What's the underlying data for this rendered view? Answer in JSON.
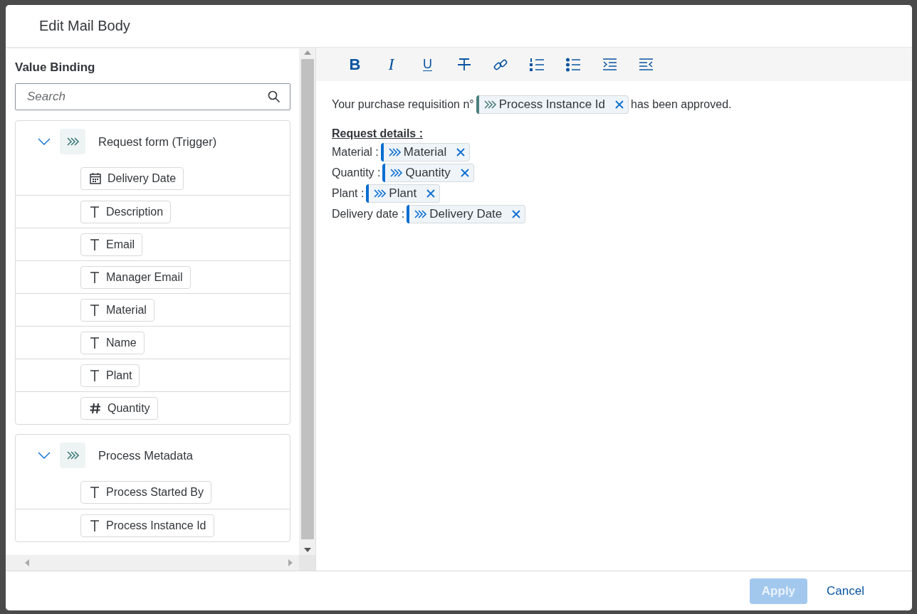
{
  "dialog": {
    "title": "Edit Mail Body"
  },
  "value_binding": {
    "title": "Value Binding",
    "search": {
      "placeholder": "Search"
    },
    "groups": [
      {
        "label": "Request form (Trigger)",
        "expanded": true,
        "fields": [
          {
            "label": "Delivery Date",
            "kind": "date"
          },
          {
            "label": "Description",
            "kind": "text"
          },
          {
            "label": "Email",
            "kind": "text"
          },
          {
            "label": "Manager Email",
            "kind": "text"
          },
          {
            "label": "Material",
            "kind": "text"
          },
          {
            "label": "Name",
            "kind": "text"
          },
          {
            "label": "Plant",
            "kind": "text"
          },
          {
            "label": "Quantity",
            "kind": "number"
          }
        ]
      },
      {
        "label": "Process Metadata",
        "expanded": true,
        "fields": [
          {
            "label": "Process Started By",
            "kind": "text"
          },
          {
            "label": "Process Instance Id",
            "kind": "text"
          }
        ]
      }
    ]
  },
  "toolbar": [
    {
      "kind": "bold",
      "label": "B"
    },
    {
      "kind": "italic",
      "label": "I"
    },
    {
      "kind": "underline",
      "label": "U"
    },
    {
      "kind": "strikethrough"
    },
    {
      "kind": "link"
    },
    {
      "kind": "numbered-list"
    },
    {
      "kind": "bulleted-list"
    },
    {
      "kind": "indent"
    },
    {
      "kind": "outdent"
    }
  ],
  "editor": {
    "lines": [
      {
        "kind": "line",
        "parts": [
          {
            "kind": "text",
            "text": "Your purchase requisition n°"
          },
          {
            "kind": "token",
            "label": "Process Instance Id",
            "color": "#4b7f7c"
          },
          {
            "kind": "text",
            "text": "has been approved."
          }
        ]
      },
      {
        "kind": "blank"
      },
      {
        "kind": "heading",
        "text": "Request details :"
      },
      {
        "kind": "line",
        "parts": [
          {
            "kind": "text",
            "text": "Material :"
          },
          {
            "kind": "token",
            "label": "Material",
            "color": "#0a6ed1"
          }
        ]
      },
      {
        "kind": "line",
        "parts": [
          {
            "kind": "text",
            "text": "Quantity :"
          },
          {
            "kind": "token",
            "label": "Quantity",
            "color": "#0a6ed1"
          }
        ]
      },
      {
        "kind": "line",
        "parts": [
          {
            "kind": "text",
            "text": "Plant :"
          },
          {
            "kind": "token",
            "label": "Plant",
            "color": "#0a6ed1"
          }
        ]
      },
      {
        "kind": "line",
        "parts": [
          {
            "kind": "text",
            "text": "Delivery date :"
          },
          {
            "kind": "token",
            "label": "Delivery Date",
            "color": "#0a6ed1"
          }
        ]
      }
    ]
  },
  "footer": {
    "buttons": [
      {
        "label": "Apply",
        "kind": "primary",
        "disabled": true
      },
      {
        "label": "Cancel",
        "kind": "transparent",
        "disabled": false
      }
    ]
  }
}
